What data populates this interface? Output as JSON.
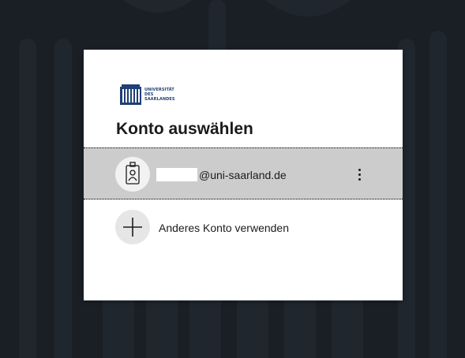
{
  "logo": {
    "lines": [
      "UNIVERSITÄT",
      "DES",
      "SAARLANDES"
    ]
  },
  "dialog": {
    "title": "Konto auswählen"
  },
  "account": {
    "email_suffix": "@uni-saarland.de",
    "icon": "badge-person-icon",
    "menu_icon": "more-options-icon"
  },
  "other_account": {
    "label": "Anderes Konto verwenden",
    "icon": "plus-icon"
  },
  "colors": {
    "background": "#1a1f25",
    "selected_row": "#cccccc",
    "brand": "#1f3f75"
  }
}
